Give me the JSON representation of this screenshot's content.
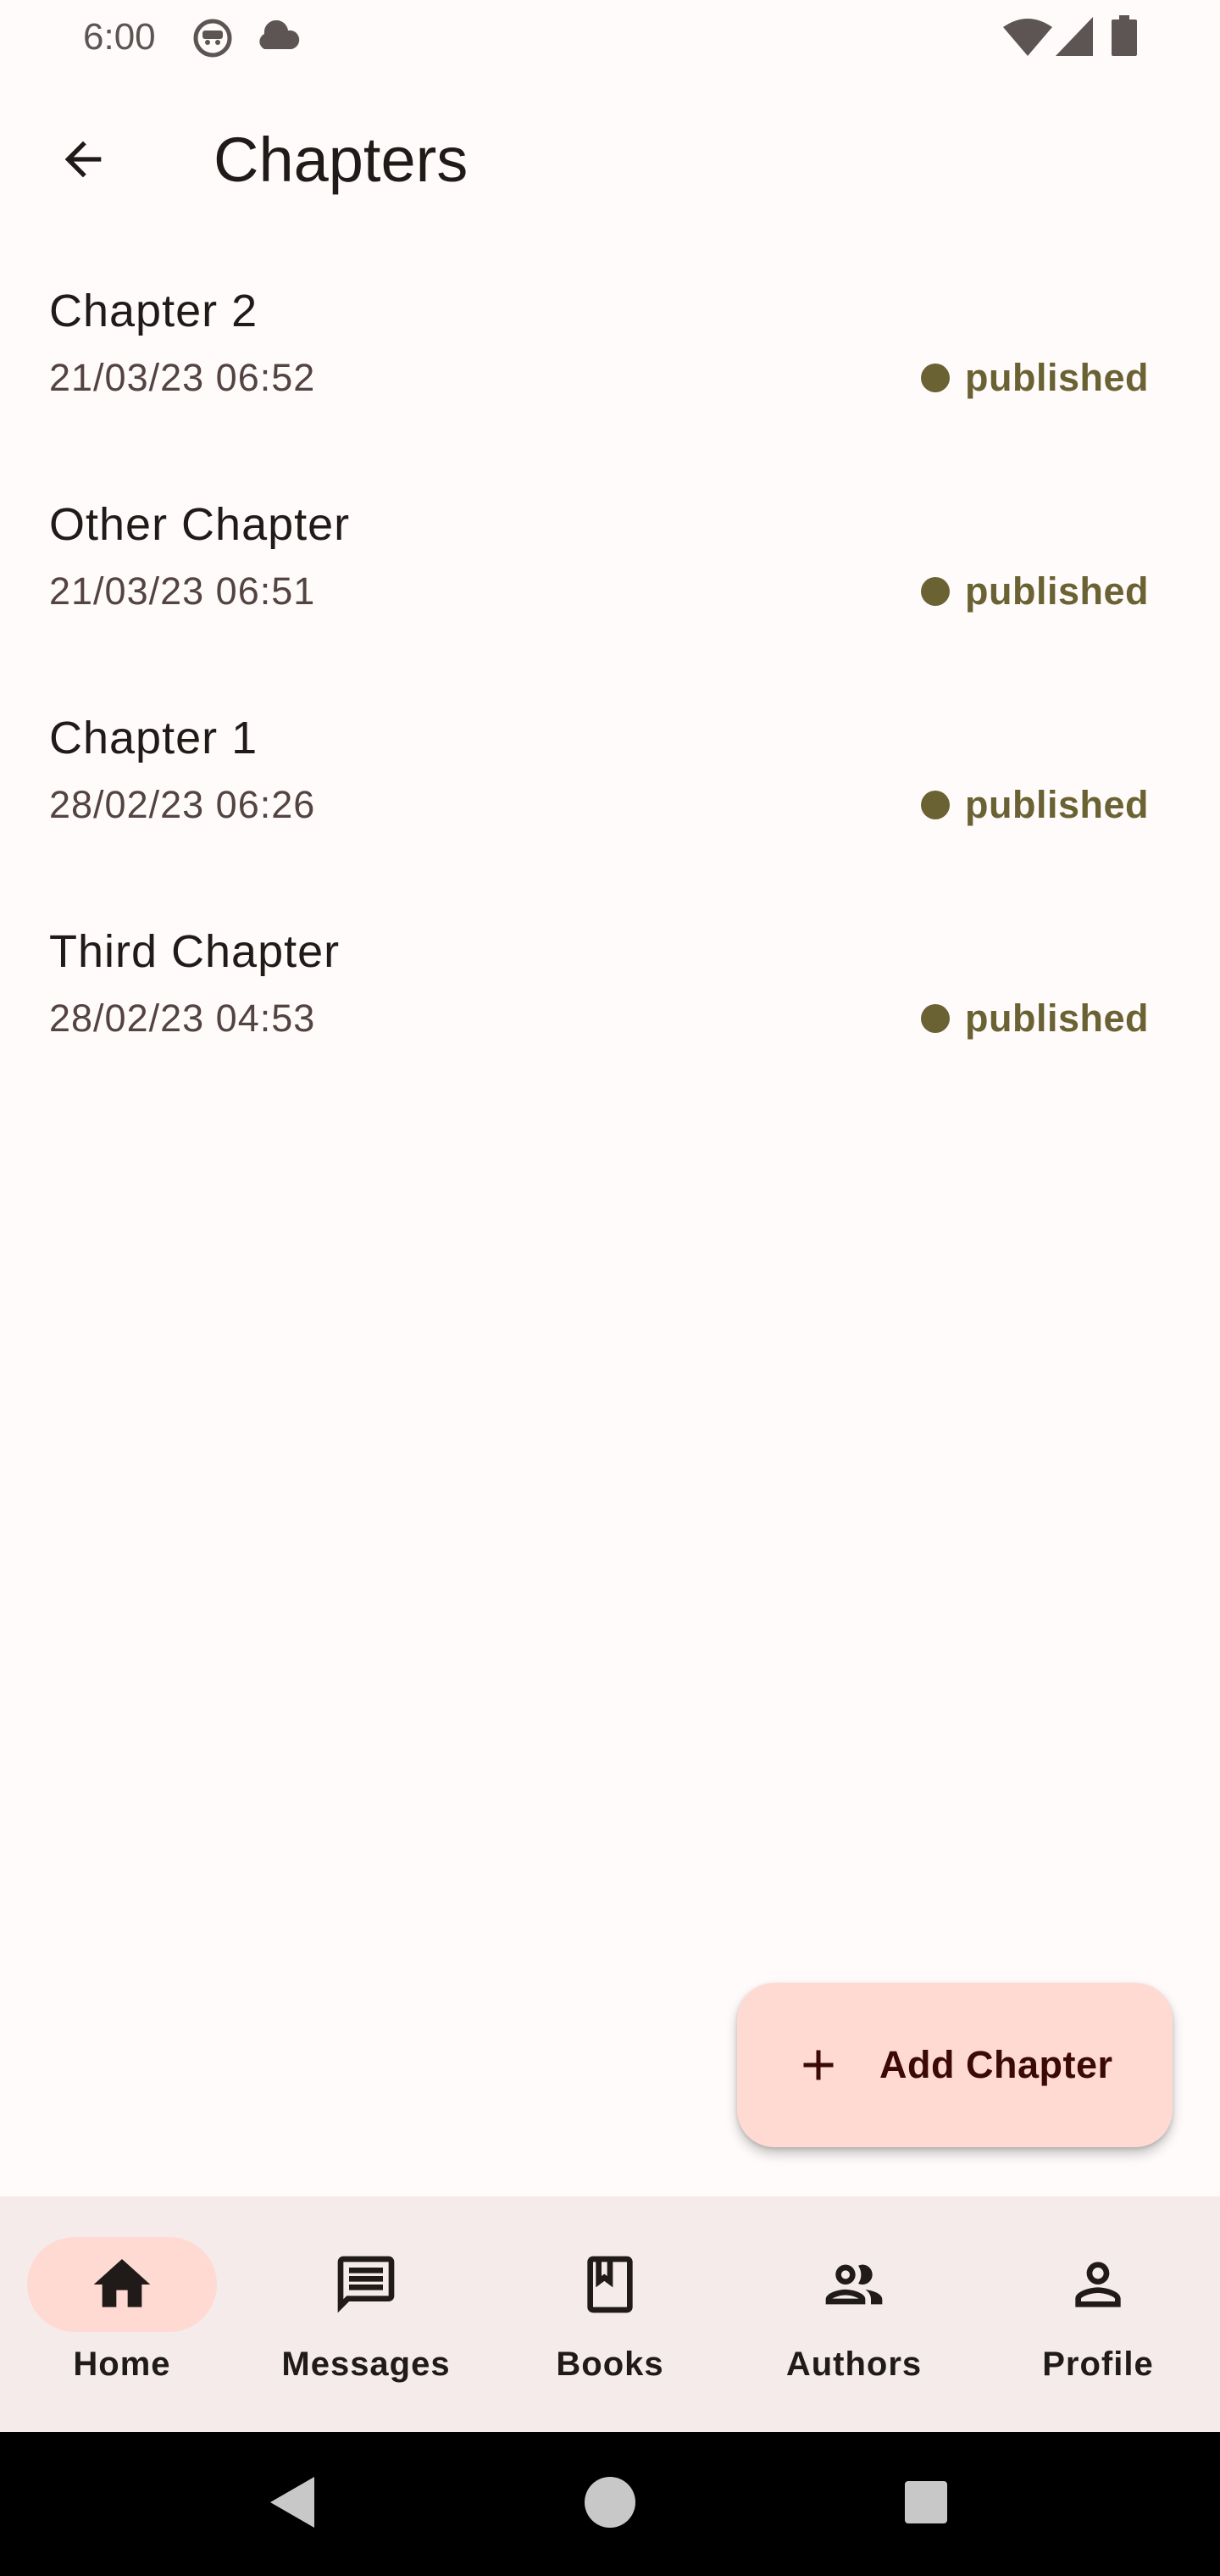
{
  "status_bar": {
    "time": "6:00",
    "left_icons": [
      "android-face-icon",
      "cloud-icon"
    ],
    "right_icons": [
      "wifi-icon",
      "signal-icon",
      "battery-icon"
    ]
  },
  "app_bar": {
    "title": "Chapters",
    "back_icon": "arrow-back-icon"
  },
  "chapters": [
    {
      "title": "Chapter 2",
      "date": "21/03/23 06:52",
      "status": "published"
    },
    {
      "title": "Other Chapter",
      "date": "21/03/23 06:51",
      "status": "published"
    },
    {
      "title": "Chapter 1",
      "date": "28/02/23 06:26",
      "status": "published"
    },
    {
      "title": "Third Chapter",
      "date": "28/02/23 04:53",
      "status": "published"
    }
  ],
  "fab": {
    "label": "Add Chapter",
    "icon": "plus-icon"
  },
  "bottom_nav": {
    "items": [
      {
        "label": "Home",
        "icon": "home-icon",
        "active": true
      },
      {
        "label": "Messages",
        "icon": "message-icon",
        "active": false
      },
      {
        "label": "Books",
        "icon": "book-icon",
        "active": false
      },
      {
        "label": "Authors",
        "icon": "people-icon",
        "active": false
      },
      {
        "label": "Profile",
        "icon": "person-icon",
        "active": false
      }
    ]
  },
  "colors": {
    "background": "#fffbfb",
    "status_published": "#6b6233",
    "fab_background": "#ffdad3",
    "nav_background": "#f5ebeb",
    "nav_active_pill": "#ffdad3"
  }
}
